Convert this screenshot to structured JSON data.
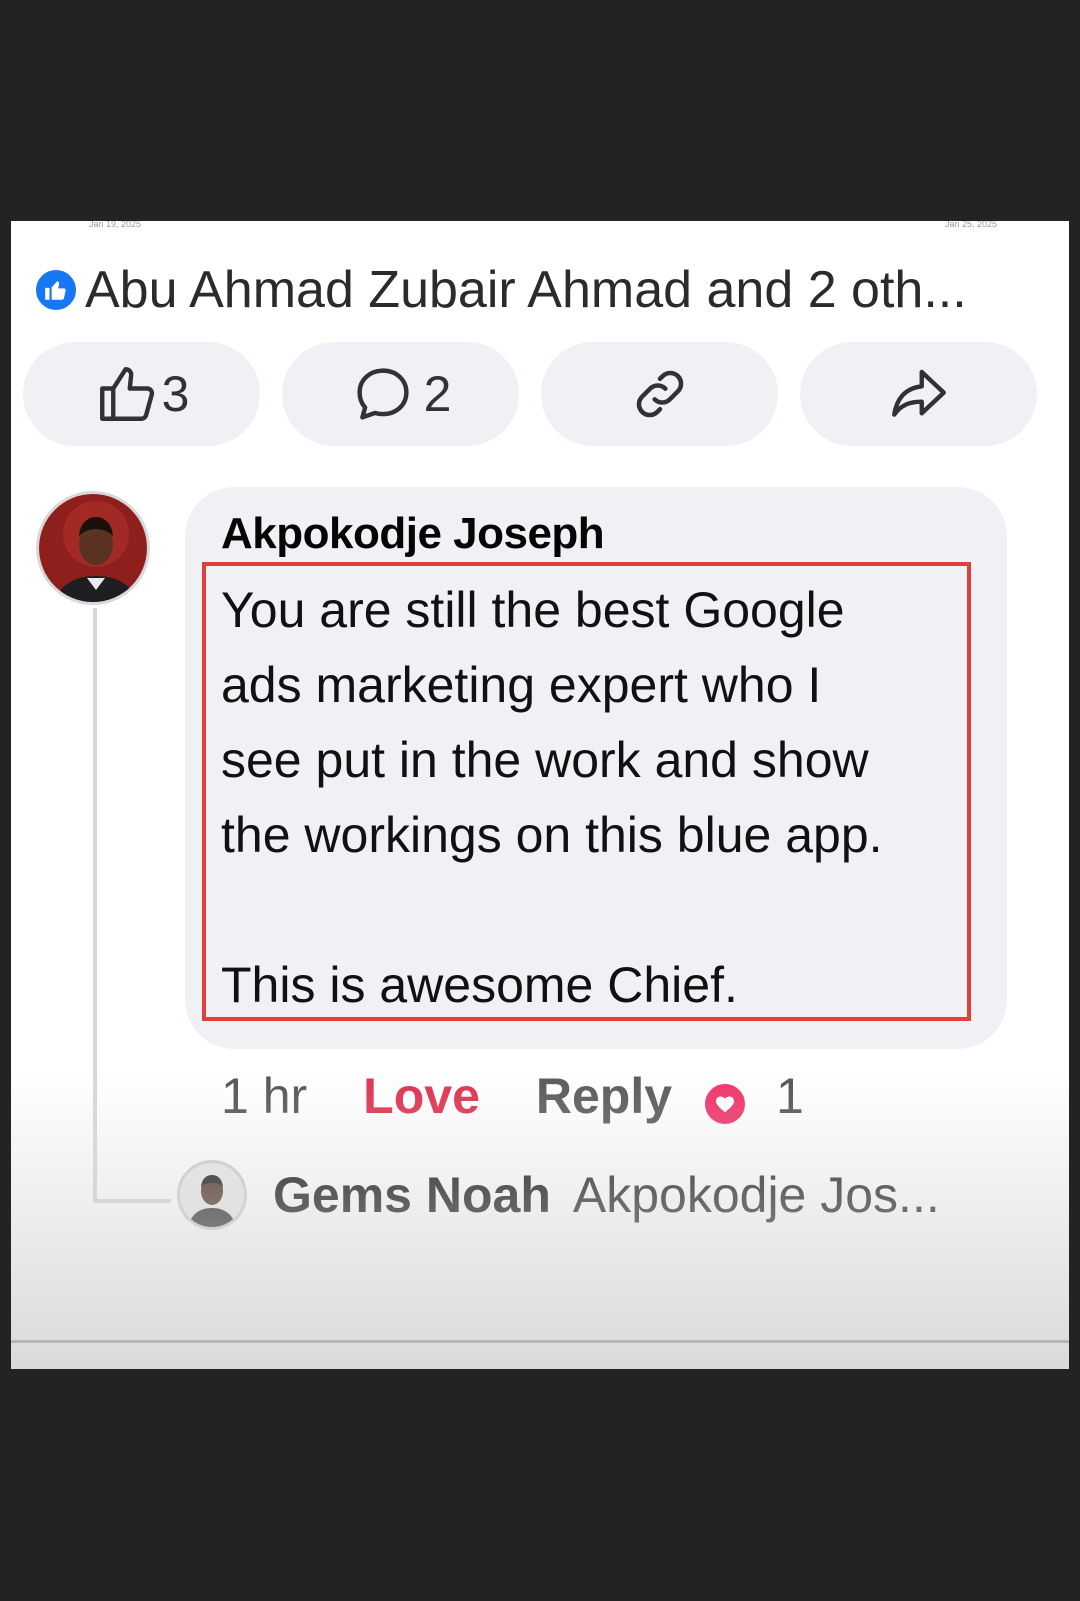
{
  "post": {
    "date_left": "Jan 19, 2025",
    "date_right": "Jan 25, 2025",
    "reaction_summary": "Abu Ahmad Zubair Ahmad and 2 oth...",
    "like_count": "3",
    "comment_count": "2"
  },
  "comment": {
    "author": "Akpokodje Joseph",
    "lines": [
      "You are still the best Google",
      "ads marketing expert who I",
      "see put in the work and show",
      "the workings on this blue app."
    ],
    "closing": "This is awesome Chief.",
    "time": "1 hr",
    "love_label": "Love",
    "reply_label": "Reply",
    "love_count": "1"
  },
  "reply": {
    "author": "Gems Noah",
    "snippet": "Akpokodje Jos..."
  },
  "colors": {
    "page_bg": "#232323",
    "facebook_blue": "#1877f2",
    "love_red": "#e0314e",
    "highlight_red": "#e0403b",
    "bubble_bg": "#f0f1f4"
  },
  "icons": [
    "like-icon",
    "thumbs-up-icon",
    "comment-icon",
    "link-icon",
    "share-icon",
    "heart-icon"
  ]
}
